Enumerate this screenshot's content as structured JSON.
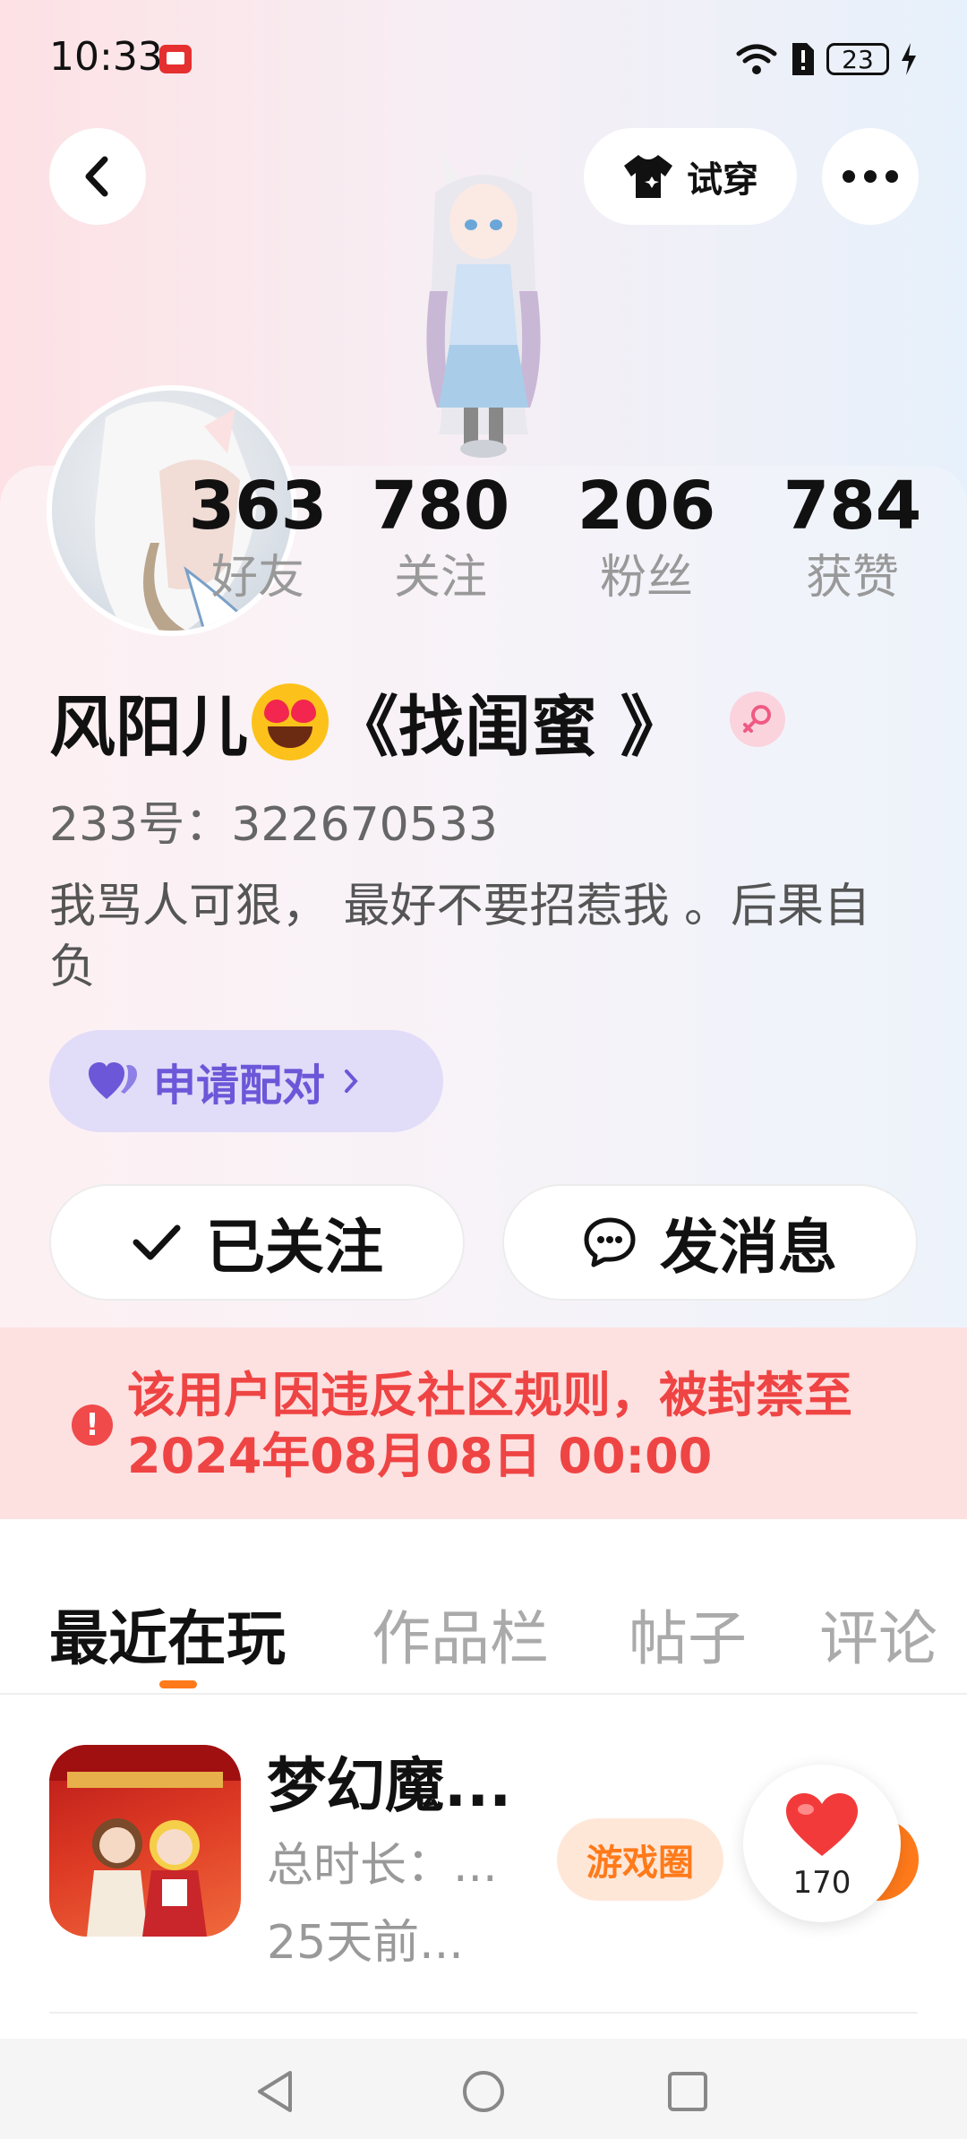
{
  "status_bar": {
    "time": "10:33",
    "battery": "23"
  },
  "header": {
    "tryon_label": "试穿"
  },
  "stats": [
    {
      "value": "363",
      "label": "好友"
    },
    {
      "value": "780",
      "label": "关注"
    },
    {
      "value": "206",
      "label": "粉丝"
    },
    {
      "value": "784",
      "label": "获赞"
    }
  ],
  "profile": {
    "name_part1": "风阳儿",
    "name_part2": "《找闺蜜 》",
    "uid": "233号：322670533",
    "bio": "我骂人可狠， 最好不要招惹我 。后果自负",
    "pair_label": "申请配对"
  },
  "actions": {
    "followed_label": "已关注",
    "message_label": "发消息"
  },
  "ban_notice": "该用户因违反社区规则，被封禁至2024年08月08日 00:00",
  "tabs": [
    {
      "label": "最近在玩"
    },
    {
      "label": "作品栏"
    },
    {
      "label": "帖子"
    },
    {
      "label": "评论"
    }
  ],
  "game": {
    "title": "梦幻魔...",
    "duration": "总时长：...",
    "last_played": "25天前...",
    "circle_label": "游戏圈",
    "like_count": "170"
  },
  "colors": {
    "accent": "#ff7a1a",
    "ban_red": "#ef4444",
    "pair_purple": "#6b57d8"
  }
}
